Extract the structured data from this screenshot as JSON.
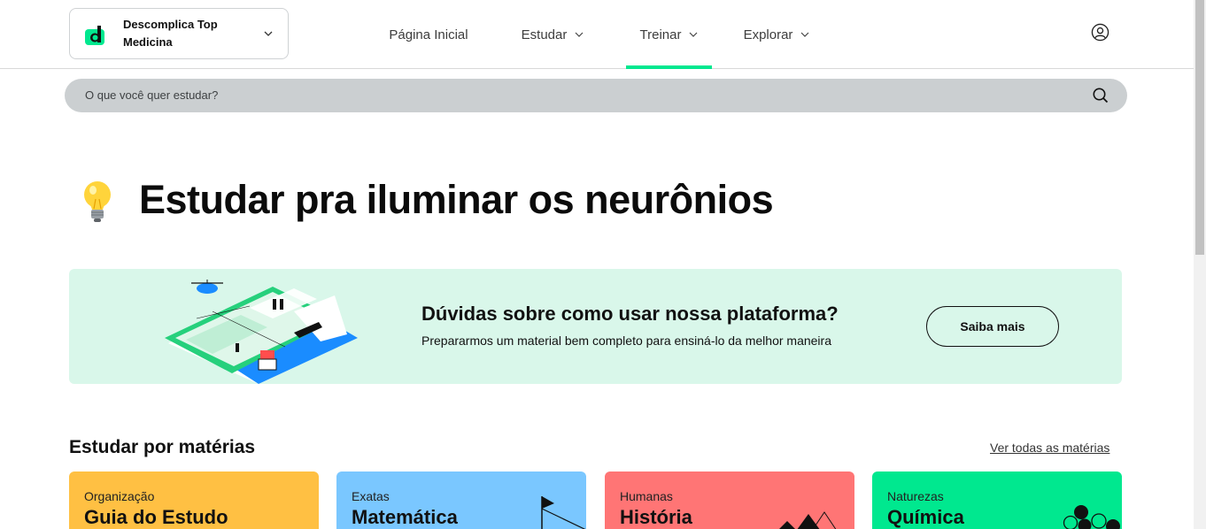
{
  "header": {
    "brand": {
      "name": "Descomplica Top Medicina",
      "logo": "d-logo-icon"
    },
    "nav": [
      {
        "label": "Página Inicial",
        "has_dropdown": false,
        "active": false
      },
      {
        "label": "Estudar",
        "has_dropdown": true,
        "active": false
      },
      {
        "label": "Treinar",
        "has_dropdown": true,
        "active": true
      },
      {
        "label": "Explorar",
        "has_dropdown": true,
        "active": false
      }
    ],
    "user_icon": "user-circle-icon"
  },
  "search": {
    "placeholder": "O que você quer estudar?",
    "icon": "search-icon"
  },
  "hero": {
    "emoji": "light-bulb-icon",
    "title": "Estudar pra iluminar os neurônios"
  },
  "banner": {
    "title": "Dúvidas sobre como usar nossa plataforma?",
    "subtitle": "Prepararmos um material bem completo para ensiná-lo da melhor maneira",
    "button": "Saiba mais"
  },
  "subjects": {
    "title": "Estudar por matérias",
    "see_all": "Ver todas as matérias",
    "cards": [
      {
        "category": "Organização",
        "name": "Guia do Estudo",
        "color": "#ffc043"
      },
      {
        "category": "Exatas",
        "name": "Matemática",
        "color": "#7ac7ff"
      },
      {
        "category": "Humanas",
        "name": "História",
        "color": "#ff7575"
      },
      {
        "category": "Naturezas",
        "name": "Química",
        "color": "#00e88f"
      }
    ]
  },
  "colors": {
    "accent": "#00e88f",
    "banner_bg": "#d9f7ea",
    "search_bg": "#cbcfd1"
  }
}
